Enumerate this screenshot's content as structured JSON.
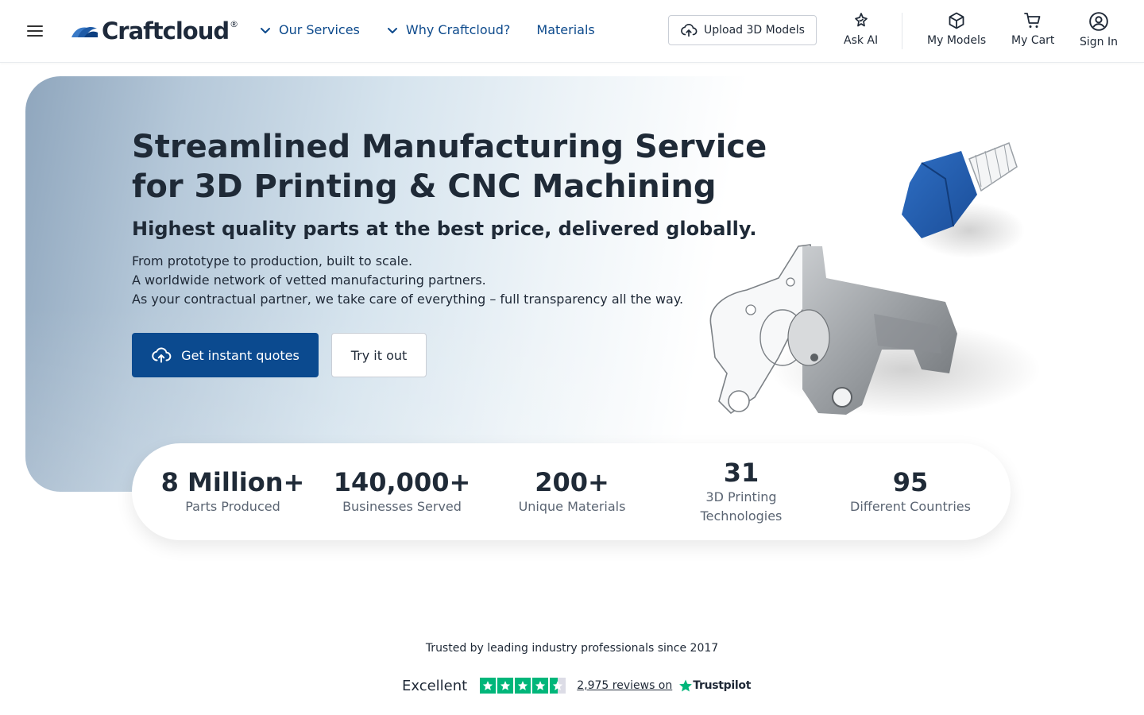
{
  "header": {
    "logo_text": "Craftcloud",
    "logo_reg": "®",
    "nav": [
      {
        "label": "Our Services"
      },
      {
        "label": "Why Craftcloud?"
      },
      {
        "label": "Materials"
      }
    ],
    "upload_label": "Upload 3D Models",
    "actions": {
      "ask_ai": "Ask AI",
      "my_models": "My Models",
      "my_cart": "My Cart",
      "sign_in": "Sign In"
    }
  },
  "hero": {
    "title_line1": "Streamlined Manufacturing Service",
    "title_line2": "for 3D Printing & CNC Machining",
    "subtitle": "Highest quality parts at the best price, delivered globally.",
    "lines": [
      "From prototype to production, built to scale.",
      "A worldwide network of vetted manufacturing partners.",
      "As your contractual partner, we take care of everything – full transparency all the way."
    ],
    "primary_cta": "Get instant quotes",
    "secondary_cta": "Try it out"
  },
  "stats": [
    {
      "value": "8 Million+",
      "label": "Parts Produced"
    },
    {
      "value": "140,000+",
      "label": "Businesses Served"
    },
    {
      "value": "200+",
      "label": "Unique Materials"
    },
    {
      "value": "31",
      "label": "3D Printing Technologies"
    },
    {
      "value": "95",
      "label": "Different Countries"
    }
  ],
  "trust": {
    "tagline": "Trusted by leading industry professionals since 2017",
    "rating_word": "Excellent",
    "stars": 4.5,
    "reviews_text": "2,975 reviews on",
    "brand": "Trustpilot"
  },
  "colors": {
    "primary": "#0b4a8f",
    "nav_link": "#0d4a8c",
    "text": "#1f2a37",
    "trustpilot_green": "#00b67a"
  },
  "icons": [
    "menu-icon",
    "chevron-down-icon",
    "cloud-upload-icon",
    "sparkle-ai-icon",
    "cube-icon",
    "cart-icon",
    "user-circle-icon",
    "star-icon"
  ]
}
